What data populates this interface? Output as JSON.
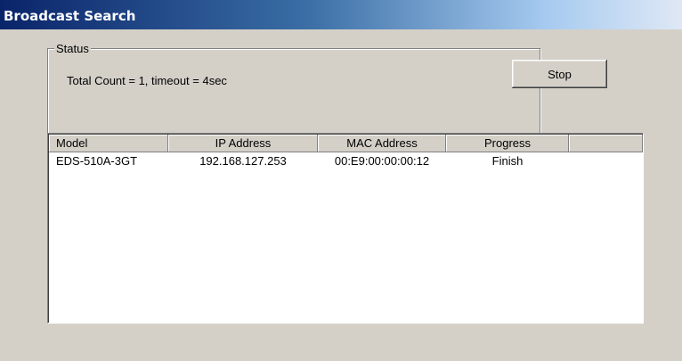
{
  "window": {
    "title": "Broadcast Search"
  },
  "status_group": {
    "legend": "Status",
    "text": "Total Count = 1, timeout = 4sec"
  },
  "stop_button": {
    "label": "Stop"
  },
  "table": {
    "columns": [
      "Model",
      "IP Address",
      "MAC Address",
      "Progress"
    ],
    "rows": [
      {
        "model": "EDS-510A-3GT",
        "ip": "192.168.127.253",
        "mac": "00:E9:00:00:00:12",
        "progress": "Finish"
      }
    ]
  }
}
